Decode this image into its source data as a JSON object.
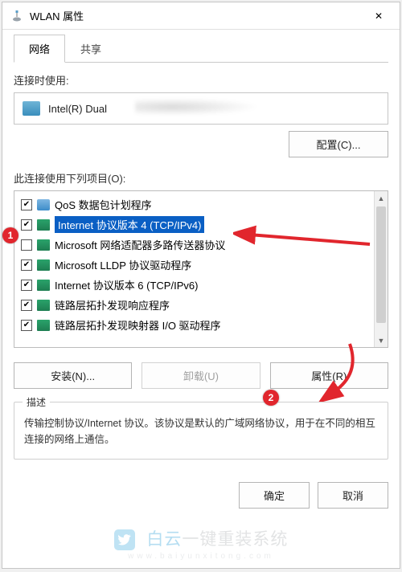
{
  "window": {
    "title": "WLAN 属性",
    "close_glyph": "✕"
  },
  "tabs": {
    "network": "网络",
    "sharing": "共享"
  },
  "adapter": {
    "label": "连接时使用:",
    "name": "Intel(R) Dual",
    "configure_btn": "配置(C)..."
  },
  "components": {
    "label": "此连接使用下列项目(O):",
    "items": [
      {
        "checked": true,
        "icon": "qos",
        "label": "QoS 数据包计划程序"
      },
      {
        "checked": true,
        "icon": "net",
        "label": "Internet 协议版本 4 (TCP/IPv4)",
        "selected": true
      },
      {
        "checked": false,
        "icon": "net",
        "label": "Microsoft 网络适配器多路传送器协议"
      },
      {
        "checked": true,
        "icon": "net",
        "label": "Microsoft LLDP 协议驱动程序"
      },
      {
        "checked": true,
        "icon": "net",
        "label": "Internet 协议版本 6 (TCP/IPv6)"
      },
      {
        "checked": true,
        "icon": "net",
        "label": "链路层拓扑发现响应程序"
      },
      {
        "checked": true,
        "icon": "net",
        "label": "链路层拓扑发现映射器 I/O 驱动程序"
      }
    ],
    "install_btn": "安装(N)...",
    "uninstall_btn": "卸载(U)",
    "properties_btn": "属性(R)"
  },
  "description": {
    "title": "描述",
    "text": "传输控制协议/Internet 协议。该协议是默认的广域网络协议，用于在不同的相互连接的网络上通信。"
  },
  "footer": {
    "ok": "确定",
    "cancel": "取消"
  },
  "annotations": {
    "marker1": "1",
    "marker2": "2"
  },
  "watermark": {
    "blue": "白云",
    "gray": "一键重装系统",
    "sub": "www.baiyunxitong.com"
  }
}
